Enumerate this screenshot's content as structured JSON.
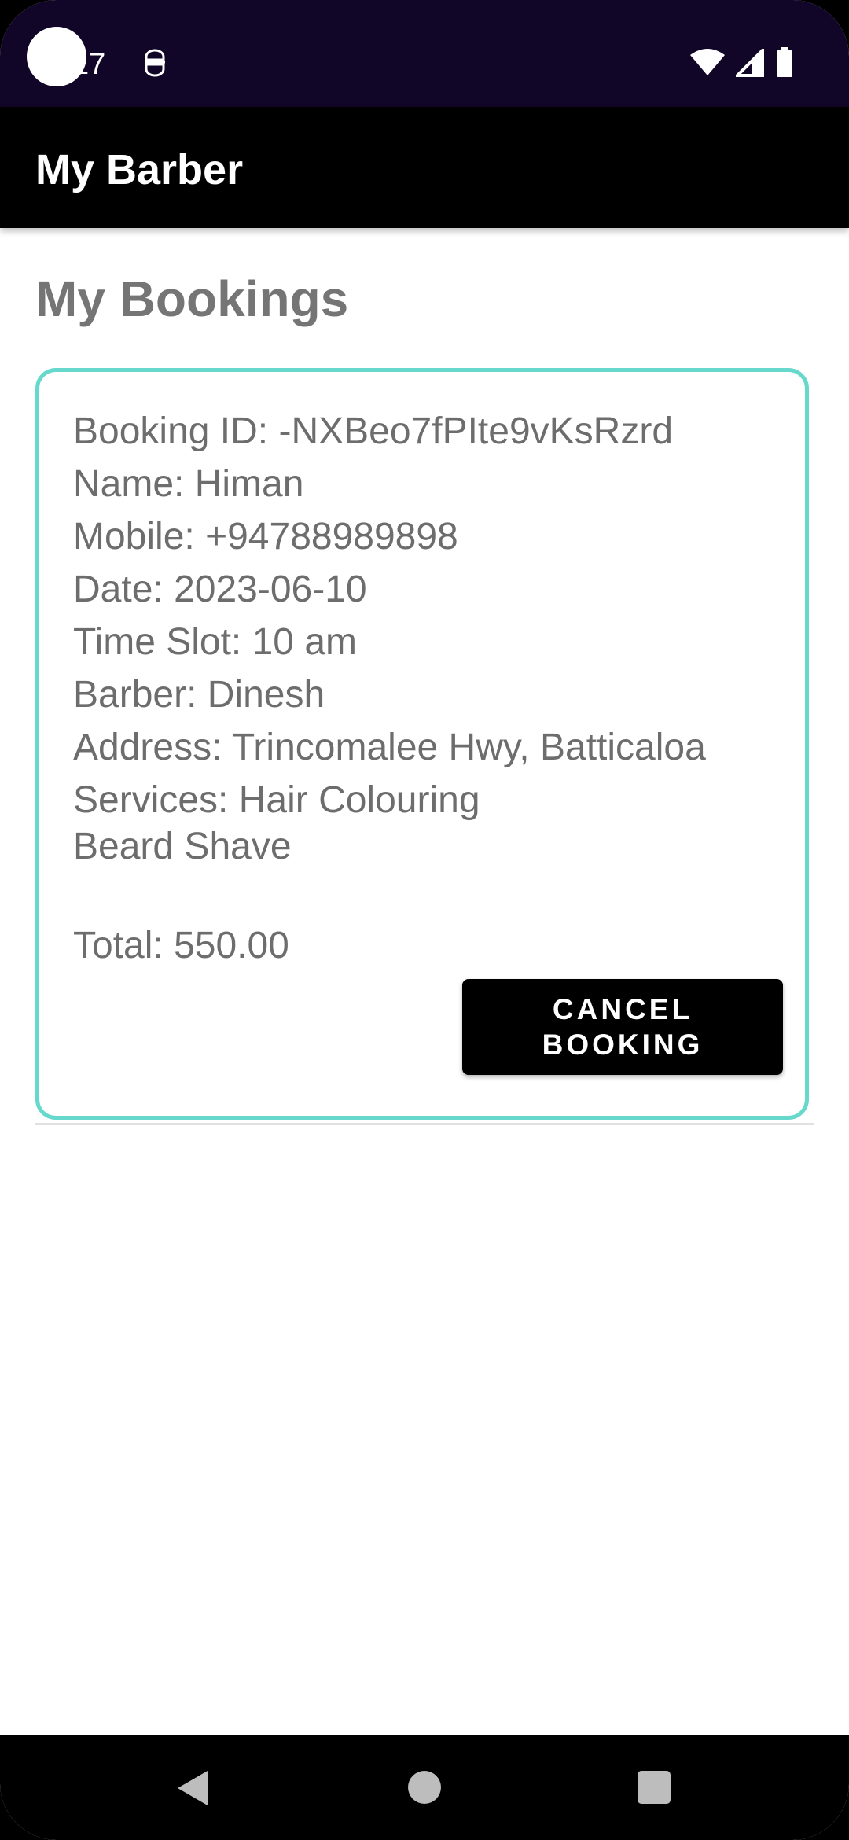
{
  "status_bar": {
    "time": "17",
    "icons": [
      "notification-icon",
      "wifi-icon",
      "signal-icon",
      "battery-icon"
    ]
  },
  "app_bar": {
    "title": "My Barber"
  },
  "page": {
    "title": "My Bookings"
  },
  "booking": {
    "booking_id": "Booking ID: -NXBeo7fPIte9vKsRzrd",
    "name": "Name: Himan",
    "mobile": "Mobile: +94788989898",
    "date": "Date: 2023-06-10",
    "time_slot": "Time Slot: 10 am",
    "barber": "Barber: Dinesh",
    "address": "Address: Trincomalee Hwy, Batticaloa",
    "services_line1": "Services: Hair Colouring",
    "services_line2": "Beard Shave",
    "total": "Total: 550.00",
    "cancel_label": "CANCEL BOOKING"
  },
  "nav_bar": {
    "buttons": [
      "back-icon",
      "home-icon",
      "recents-icon"
    ]
  },
  "colors": {
    "status_bar": "#120628",
    "app_bar": "#000000",
    "card_border": "#66d8cc",
    "text_gray": "#6d6d6d",
    "heading_gray": "#757575"
  }
}
